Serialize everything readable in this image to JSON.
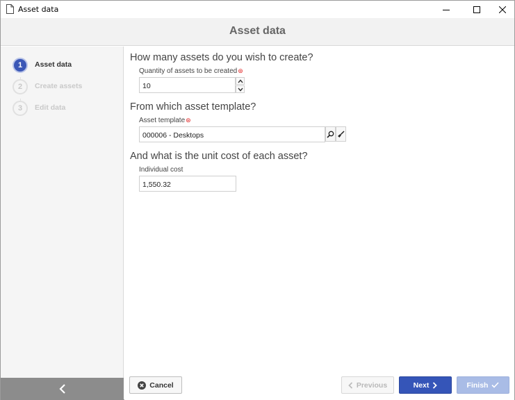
{
  "window": {
    "title": "Asset data"
  },
  "header": {
    "title": "Asset data"
  },
  "wizard": {
    "steps": [
      {
        "number": "1",
        "label": "Asset data",
        "state": "active"
      },
      {
        "number": "2",
        "label": "Create assets",
        "state": "inactive"
      },
      {
        "number": "3",
        "label": "Edit data",
        "state": "inactive"
      }
    ]
  },
  "form": {
    "q1": {
      "question": "How many assets do you wish to create?",
      "label": "Quantity of assets to be created",
      "value": "10"
    },
    "q2": {
      "question": "From which asset template?",
      "label": "Asset template",
      "value": "000006 - Desktops"
    },
    "q3": {
      "question": "And what is the unit cost of each asset?",
      "label": "Individual cost",
      "value": "1,550.32"
    },
    "required_marker": "⊛"
  },
  "footer": {
    "cancel_label": "Cancel",
    "previous_label": "Previous",
    "next_label": "Next",
    "finish_label": "Finish"
  },
  "colors": {
    "accent": "#3555b8",
    "finish_disabled": "#a9bce6",
    "required": "#e02020",
    "left_footer": "#8c8c8c"
  },
  "icons": [
    "document-icon",
    "minimize-icon",
    "maximize-icon",
    "close-icon",
    "collapse-left-icon",
    "chevron-up-icon",
    "chevron-down-icon",
    "search-icon",
    "clear-brush-icon",
    "cancel-x-icon",
    "chevron-left-icon",
    "chevron-right-icon",
    "checkmark-icon"
  ]
}
